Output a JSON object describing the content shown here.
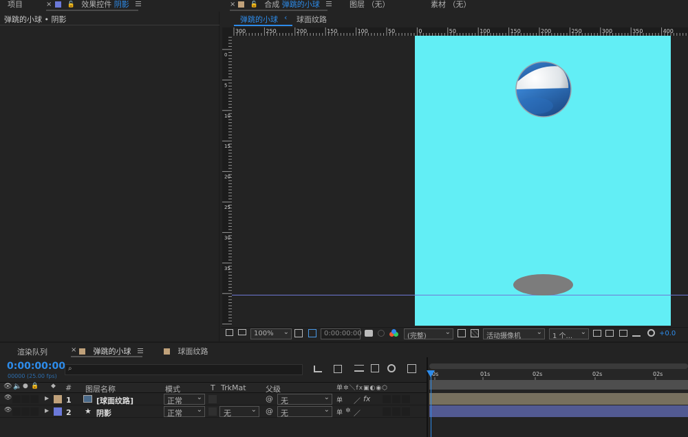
{
  "top_tabs": {
    "project": "项目",
    "effects_prefix": "效果控件",
    "effects_layer": "阴影",
    "comp_prefix": "合成",
    "comp_name": "弹跳的小球",
    "layer_tab": "图层 （无）",
    "footage_tab": "素材 （无）"
  },
  "effects_panel": {
    "breadcrumb": "弹跳的小球 • 阴影"
  },
  "comp_viewer": {
    "sub_tab_active": "弹跳的小球",
    "sub_tab_other": "球面纹路",
    "ruler_h": [
      "300",
      "250",
      "200",
      "150",
      "100",
      "50",
      "0",
      "50",
      "100",
      "150",
      "200",
      "250",
      "300",
      "350",
      "400"
    ],
    "ruler_v": [
      "0",
      "5",
      "10",
      "15",
      "20",
      "25",
      "30",
      "35"
    ],
    "bg_color": "#62eef5",
    "ball_colors": {
      "dark": "#1f5fa8",
      "mid": "#3a86d6",
      "light": "#ffffff"
    },
    "shadow_color": "#7c7c7c",
    "guide_color": "#6f78d6"
  },
  "viewer_toolbar": {
    "zoom": "100%",
    "timecode": "0:00:00:00",
    "resolution": "(完整)",
    "camera": "活动摄像机",
    "views": "1 个...",
    "exposure": "+0.0"
  },
  "bottom_tabs": {
    "render_queue": "渲染队列",
    "comp1": "弹跳的小球",
    "comp2": "球面纹路",
    "comp1_color": "#c0a17a",
    "comp2_color": "#c0a17a"
  },
  "timeline": {
    "timecode": "0:00:00:00",
    "frames": "00000 (25.00 fps)",
    "search_placeholder": "",
    "headers": {
      "num": "#",
      "layer_name": "图层名称",
      "mode": "模式",
      "t": "T",
      "trkmat": "TrkMat",
      "parent": "父级"
    },
    "ruler": [
      "0s",
      "01s",
      "02s",
      "02s",
      "02s"
    ],
    "layers": [
      {
        "num": "1",
        "name": "[球面纹路]",
        "mode": "正常",
        "trkmat": "",
        "parent": "无",
        "label_color": "#c0a17a",
        "bar_color": "#77705e",
        "switches": "fx"
      },
      {
        "num": "2",
        "name": "阴影",
        "mode": "正常",
        "trkmat": "无",
        "parent": "无",
        "label_color": "#6b79d9",
        "bar_color": "#525a92",
        "switches": ""
      }
    ]
  }
}
